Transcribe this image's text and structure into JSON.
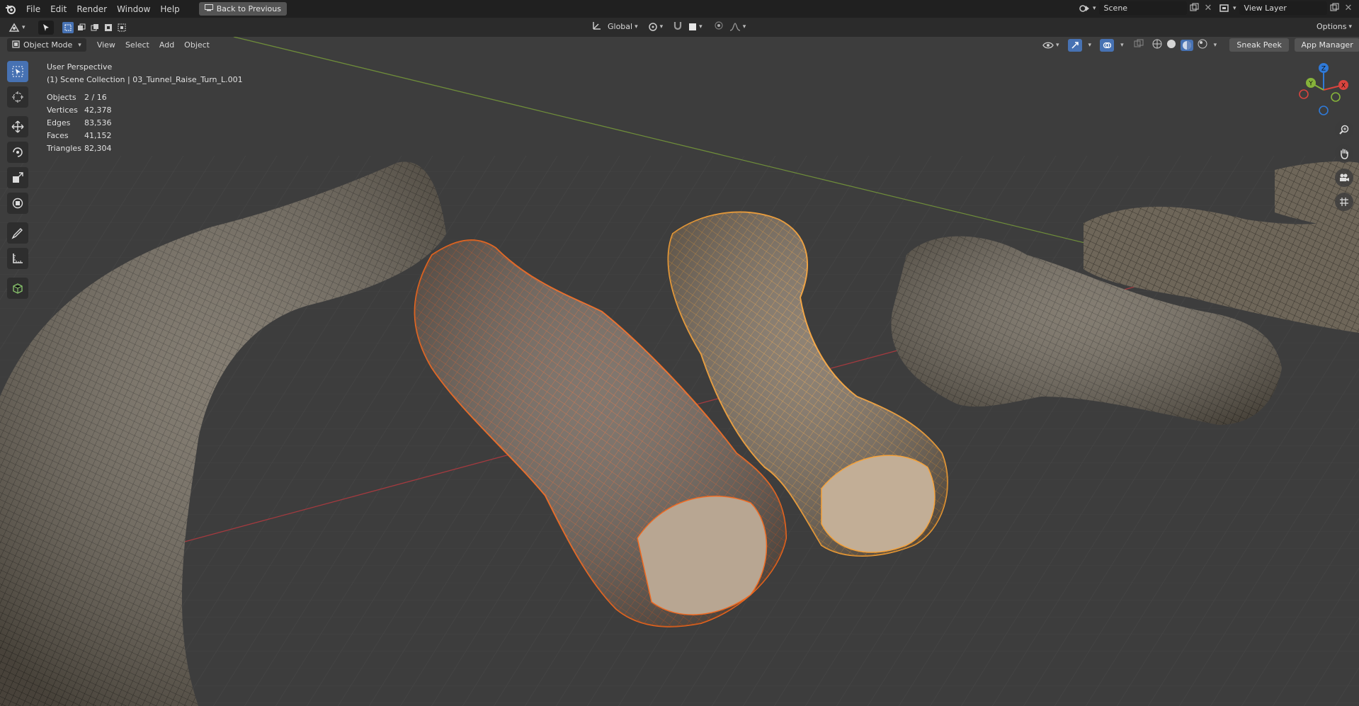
{
  "menu": {
    "items": [
      "File",
      "Edit",
      "Render",
      "Window",
      "Help"
    ],
    "back_button": "Back to Previous"
  },
  "scene": {
    "name": "Scene",
    "view_layer": "View Layer"
  },
  "header": {
    "transform_orientation": "Global",
    "options_label": "Options",
    "mode": "Object Mode",
    "view_menus": [
      "View",
      "Select",
      "Add",
      "Object"
    ],
    "addons": [
      "Sneak Peek",
      "App Manager"
    ]
  },
  "viewport": {
    "perspective_label": "User Perspective",
    "collection_label": "(1) Scene Collection | 03_Tunnel_Raise_Turn_L.001",
    "stats": [
      {
        "label": "Objects",
        "value": "2 / 16"
      },
      {
        "label": "Vertices",
        "value": "42,378"
      },
      {
        "label": "Edges",
        "value": "83,536"
      },
      {
        "label": "Faces",
        "value": "41,152"
      },
      {
        "label": "Triangles",
        "value": "82,304"
      }
    ]
  },
  "gizmo": {
    "x": "X",
    "y": "Y",
    "z": "Z"
  },
  "colors": {
    "active_orange": "#f06a21",
    "selected_orange": "#f5a23a",
    "accent_blue": "#4772b3",
    "x_axis": "#b8323d",
    "y_axis": "#6d9a2a"
  }
}
